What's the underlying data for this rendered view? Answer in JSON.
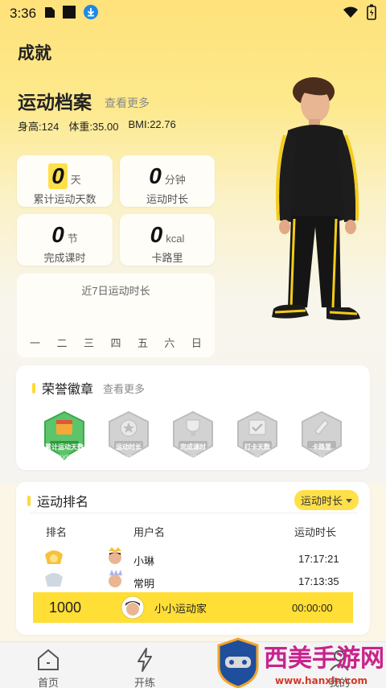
{
  "status_bar": {
    "time": "3:36"
  },
  "page": {
    "title": "成就"
  },
  "profile": {
    "title": "运动档案",
    "more": "查看更多",
    "height_label": "身高:124",
    "weight_label": "体重:35.00",
    "bmi_label": "BMI:22.76"
  },
  "stats": [
    {
      "value": "0",
      "unit": "天",
      "label": "累计运动天数"
    },
    {
      "value": "0",
      "unit": "分钟",
      "label": "运动时长"
    },
    {
      "value": "0",
      "unit": "节",
      "label": "完成课时"
    },
    {
      "value": "0",
      "unit": "kcal",
      "label": "卡路里"
    }
  ],
  "weekly": {
    "title": "近7日运动时长",
    "days": [
      "一",
      "二",
      "三",
      "四",
      "五",
      "六",
      "日"
    ]
  },
  "badges_section": {
    "title": "荣誉徽章",
    "more": "查看更多",
    "badges": [
      {
        "label": "累计运动天数",
        "level": "LV1",
        "active": true
      },
      {
        "label": "运动时长",
        "level": "LV1",
        "active": false
      },
      {
        "label": "完成课时",
        "level": "LV1",
        "active": false
      },
      {
        "label": "打卡天数",
        "level": "LV1",
        "active": false
      },
      {
        "label": "卡路里",
        "level": "LV1",
        "active": false
      }
    ]
  },
  "ranking": {
    "title": "运动排名",
    "dropdown": "运动时长",
    "headers": {
      "rank": "排名",
      "user": "用户名",
      "time": "运动时长"
    },
    "rows": [
      {
        "name": "小琳",
        "time": "17:17:21"
      },
      {
        "name": "常明",
        "time": "17:13:35"
      }
    ],
    "me": {
      "rank": "1000",
      "name": "小小运动家",
      "time": "00:00:00"
    }
  },
  "tabbar": {
    "items": [
      {
        "label": "首页",
        "icon": "home-icon"
      },
      {
        "label": "开练",
        "icon": "lightning-icon"
      },
      {
        "label": "我的",
        "icon": "user-icon"
      }
    ]
  },
  "watermark": {
    "text": "西美手游网",
    "url": "www.hanxin.com"
  },
  "colors": {
    "accent": "#ffde35",
    "badge_active": "#5cc46a",
    "badge_inactive": "#cfcfcf"
  }
}
